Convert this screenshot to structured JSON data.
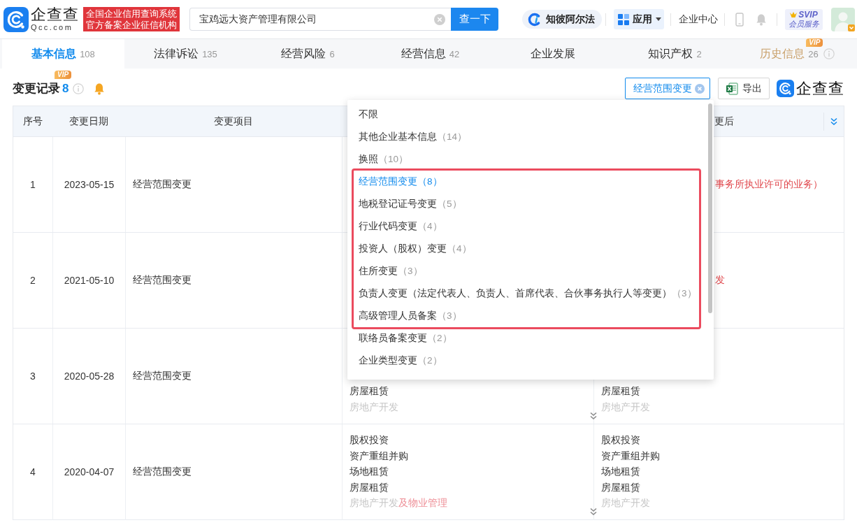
{
  "header": {
    "logo": {
      "name": "企查查",
      "domain": "Qcc.com"
    },
    "banner_lines": [
      "全国企业信用查询系统",
      "官方备案企业征信机构"
    ],
    "search": {
      "value": "宝鸡远大资产管理有限公司",
      "button": "查一下"
    },
    "alpha_button": "知彼阿尔法",
    "apps_button": "应用",
    "enterprise_center": "企业中心",
    "svip": {
      "title": "SVIP",
      "subtitle": "会员服务"
    }
  },
  "tabs": [
    {
      "label": "基本信息",
      "count": "108",
      "selected": true,
      "vip": false
    },
    {
      "label": "法律诉讼",
      "count": "135",
      "selected": false,
      "vip": false
    },
    {
      "label": "经营风险",
      "count": "6",
      "selected": false,
      "vip": false
    },
    {
      "label": "经营信息",
      "count": "42",
      "selected": false,
      "vip": false
    },
    {
      "label": "企业发展",
      "selected": false,
      "vip": false
    },
    {
      "label": "知识产权",
      "count": "2",
      "selected": false,
      "vip": false
    },
    {
      "label": "历史信息",
      "count": "26",
      "badge": "VIP",
      "selected": false,
      "vip": true
    }
  ],
  "section": {
    "title": "变更记录",
    "count": "8",
    "badge": "VIP"
  },
  "toolbar": {
    "filter": "经营范围变更",
    "export": "导出",
    "brand": "企查查"
  },
  "dropdown": {
    "items": [
      {
        "label": "不限",
        "selected": false,
        "highlighted": false
      },
      {
        "label": "其他企业基本信息",
        "count": "（14）",
        "selected": false,
        "highlighted": false
      },
      {
        "label": "换照",
        "count": "（10）",
        "selected": false,
        "highlighted": false
      },
      {
        "label": "经营范围变更",
        "count": "（8）",
        "selected": true,
        "highlighted": true
      },
      {
        "label": "地税登记证号变更",
        "count": "（5）",
        "selected": false,
        "highlighted": true
      },
      {
        "label": "行业代码变更",
        "count": "（4）",
        "selected": false,
        "highlighted": true
      },
      {
        "label": "投资人（股权）变更",
        "count": "（4）",
        "selected": false,
        "highlighted": true
      },
      {
        "label": "住所变更",
        "count": "（3）",
        "selected": false,
        "highlighted": true
      },
      {
        "label": "负责人变更（法定代表人、负责人、首席代表、合伙事务执行人等变更）",
        "count": "（3）",
        "selected": false,
        "highlighted": true
      },
      {
        "label": "高级管理人员备案",
        "count": "（3）",
        "selected": false,
        "highlighted": true
      },
      {
        "label": "联络员备案变更",
        "count": "（2）",
        "selected": false,
        "highlighted": false
      },
      {
        "label": "企业类型变更",
        "count": "（2）",
        "selected": false,
        "highlighted": false
      }
    ]
  },
  "table": {
    "columns": [
      {
        "label": "序号",
        "kind": "full"
      },
      {
        "label": "变更日期",
        "kind": "full"
      },
      {
        "label": "变更项目",
        "kind": "full"
      },
      {
        "label": "更后",
        "kind": "cut"
      }
    ],
    "rows": [
      {
        "index": "1",
        "date": "2023-05-15",
        "item": "经营范围变更",
        "after": [
          {
            "kind": "cut",
            "parts": [
              {
                "text": "事务所执业许可的业务）",
                "changed": true
              }
            ]
          }
        ],
        "collapsed": false
      },
      {
        "index": "2",
        "date": "2021-05-10",
        "item": "经营范围变更",
        "after": [
          {
            "kind": "cut",
            "parts": [
              {
                "text": "发",
                "changed": true
              }
            ]
          }
        ],
        "collapsed": false
      },
      {
        "index": "3",
        "date": "2020-05-28",
        "item": "经营范围变更",
        "before": [
          {
            "kind": "full",
            "parts": [
              {
                "text": "房屋租赁",
                "changed": false
              }
            ]
          },
          {
            "kind": "full",
            "parts": [
              {
                "text": "房地产开发",
                "changed": false
              }
            ]
          }
        ],
        "after": [
          {
            "kind": "full",
            "parts": [
              {
                "text": "房屋租赁",
                "changed": false
              }
            ]
          },
          {
            "kind": "full",
            "parts": [
              {
                "text": "房地产开发",
                "changed": false
              }
            ]
          }
        ],
        "collapsed": true
      },
      {
        "index": "4",
        "date": "2020-04-07",
        "item": "经营范围变更",
        "before": [
          {
            "kind": "full",
            "parts": [
              {
                "text": "股权投资",
                "changed": false
              }
            ]
          },
          {
            "kind": "full",
            "parts": [
              {
                "text": "资产重组并购",
                "changed": false
              }
            ]
          },
          {
            "kind": "full",
            "parts": [
              {
                "text": "场地租赁",
                "changed": false
              }
            ]
          },
          {
            "kind": "full",
            "parts": [
              {
                "text": "房屋租赁",
                "changed": false
              }
            ]
          },
          {
            "kind": "full",
            "parts": [
              {
                "text": "房地产开发",
                "changed": false
              },
              {
                "text": "及物业管理",
                "changed": true
              }
            ]
          }
        ],
        "after": [
          {
            "kind": "full",
            "parts": [
              {
                "text": "股权投资",
                "changed": false
              }
            ]
          },
          {
            "kind": "full",
            "parts": [
              {
                "text": "资产重组并购",
                "changed": false
              }
            ]
          },
          {
            "kind": "full",
            "parts": [
              {
                "text": "场地租赁",
                "changed": false
              }
            ]
          },
          {
            "kind": "full",
            "parts": [
              {
                "text": "房屋租赁",
                "changed": false
              }
            ]
          },
          {
            "kind": "full",
            "parts": [
              {
                "text": "房地产开发",
                "changed": false
              }
            ]
          }
        ],
        "collapsed": true
      }
    ]
  }
}
